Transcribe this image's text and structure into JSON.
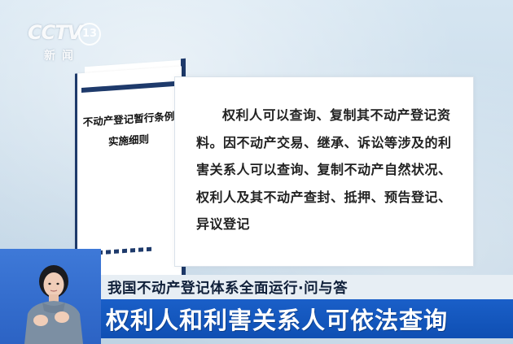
{
  "logo": {
    "brand": "CCTV",
    "channel_number": "13",
    "channel_name": "新闻"
  },
  "booklet": {
    "title_line1": "不动产登记暂行条例",
    "title_line2": "实施细则"
  },
  "card": {
    "body": "权利人可以查询、复制其不动产登记资料。因不动产交易、继承、诉讼等涉及的利害关系人可以查询、复制不动产自然状况、权利人及其不动产查封、抵押、预告登记、异议登记"
  },
  "caption": {
    "top": "我国不动产登记体系全面运行·问与答",
    "headline": "权利人和利害关系人可依法查询"
  },
  "colors": {
    "navy": "#1e3a6b",
    "caption_blue": "#0f4fb3",
    "caption_light": "#e7eef4"
  },
  "icons": {
    "logo": "cctv-logo-icon",
    "presenter": "sign-language-presenter-icon"
  }
}
